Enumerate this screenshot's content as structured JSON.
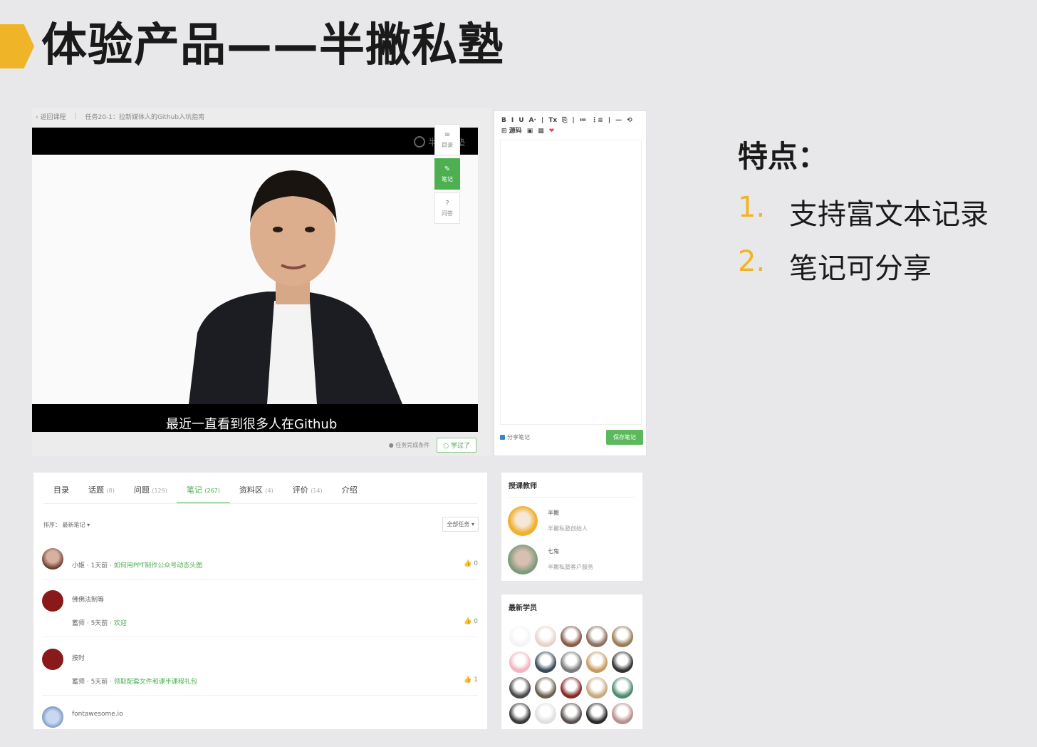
{
  "slide": {
    "title": "体验产品——半撇私塾"
  },
  "player": {
    "back_label": "‹ 返回课程",
    "task_label": "任务20-1：拉新媒体人的Github入坑指南",
    "watermark": "半撇私塾",
    "subtitle": "最近一直看到很多人在Github",
    "complete_hint": "● 任务完成条件",
    "learned_button": "○ 学过了"
  },
  "side_tabs": [
    {
      "icon": "≡",
      "label": "目录",
      "active": false
    },
    {
      "icon": "✎",
      "label": "笔记",
      "active": true
    },
    {
      "icon": "?",
      "label": "问答",
      "active": false
    }
  ],
  "editor": {
    "toolbar_row1": [
      "B",
      "I",
      "U",
      "A·",
      "|",
      "Tx",
      "⎘",
      "|",
      "≔",
      "⋮≡",
      "|",
      "—",
      "⟲"
    ],
    "toolbar_row2": [
      "⊞ 源码",
      "▣",
      "▦",
      "❤"
    ],
    "share_label": "分享笔记",
    "save_button": "保存笔记"
  },
  "features": {
    "title": "特点：",
    "items": [
      {
        "num": "1.",
        "text": "支持富文本记录"
      },
      {
        "num": "2.",
        "text": "笔记可分享"
      }
    ]
  },
  "course_tabs": [
    {
      "label": "目录",
      "count": "",
      "active": false
    },
    {
      "label": "话题",
      "count": "(8)",
      "active": false
    },
    {
      "label": "问题",
      "count": "(129)",
      "active": false
    },
    {
      "label": "笔记",
      "count": "(267)",
      "active": true
    },
    {
      "label": "资料区",
      "count": "(4)",
      "active": false
    },
    {
      "label": "评价",
      "count": "(14)",
      "active": false
    },
    {
      "label": "介绍",
      "count": "",
      "active": false
    }
  ],
  "sort": {
    "label": "排序：",
    "value": "最新笔记 ▾",
    "filter": "全部任务 ▾"
  },
  "notes": [
    {
      "name": "",
      "meta": "小姬 · 1天前 · ",
      "link": "如何用PPT制作公众号动态头图",
      "likes": "0"
    },
    {
      "name": "佛佛法制等",
      "meta": "蓄师 · 5天前 · ",
      "link": "欢迎",
      "likes": "0"
    },
    {
      "name": "按时",
      "meta": "蓄师 · 5天前 · ",
      "link": "领取配套文件和课半课程礼包",
      "likes": "1"
    },
    {
      "name": "fontawesome.io",
      "meta": "",
      "link": "",
      "likes": ""
    }
  ],
  "teachers": {
    "heading": "授课教师",
    "items": [
      {
        "name": "半撇",
        "role": "半撇私塾创始人"
      },
      {
        "name": "七鬼",
        "role": "半撇私塾客户服务"
      }
    ]
  },
  "students": {
    "heading": "最新学员",
    "avatar_colors": [
      "#f4f4f4",
      "#e6d4cc",
      "#8a5a48",
      "#8a7060",
      "#9a7c58",
      "#f2b4c0",
      "#3b4a5a",
      "#7a7a7a",
      "#c89a60",
      "#333333",
      "#4a4a4a",
      "#6a6050",
      "#8a2a28",
      "#c8a880",
      "#4e8a6e",
      "#3a3a3a",
      "#e0e0e0",
      "#5a5050",
      "#2a2a2a",
      "#b89090"
    ],
    "accent": "#4caf50"
  },
  "colors": {
    "accent_green": "#4caf50",
    "title_marker": "#f0b428",
    "feature_number": "#f0b428"
  }
}
